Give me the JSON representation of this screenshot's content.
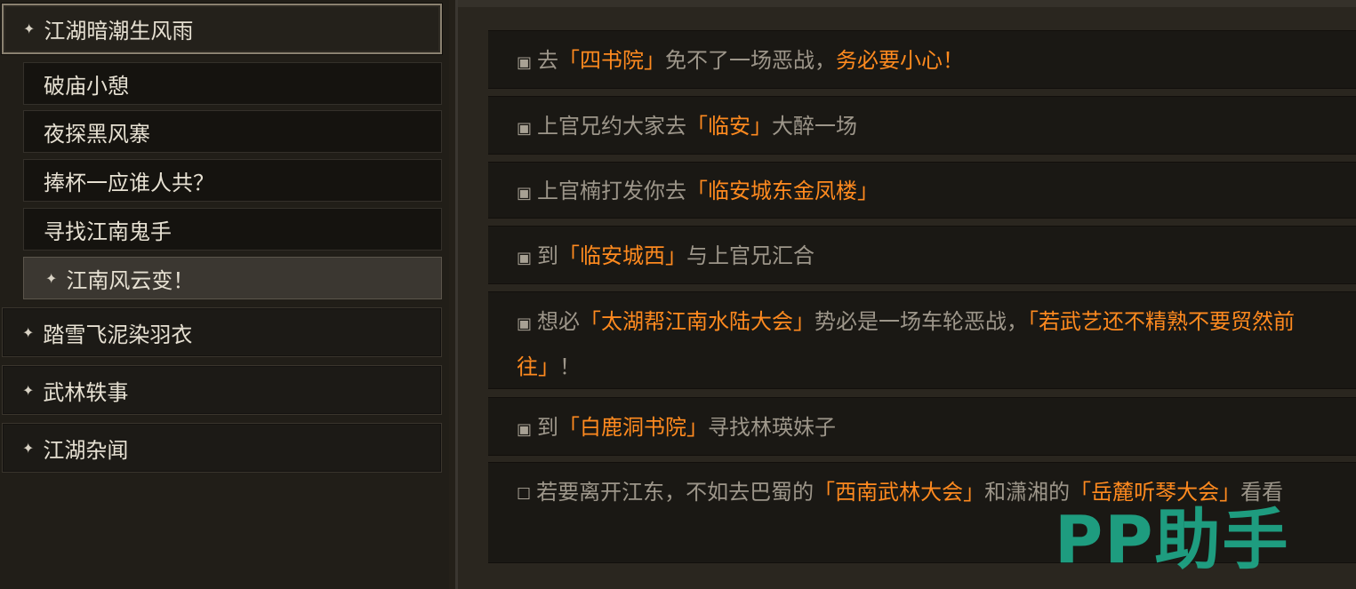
{
  "chapters": [
    {
      "icon": "plus-icon",
      "label": "江湖暗潮生风雨"
    },
    {
      "icon": "plus-icon",
      "label": "踏雪飞泥染羽衣"
    },
    {
      "icon": "plus-icon",
      "label": "武林轶事"
    },
    {
      "icon": "plus-icon",
      "label": "江湖杂闻"
    }
  ],
  "quests": [
    {
      "label": "破庙小憩"
    },
    {
      "label": "夜探黑风寨"
    },
    {
      "label": "捧杯一应谁人共？"
    },
    {
      "label": "寻找江南鬼手"
    },
    {
      "icon": "plus-icon",
      "label": "江南风云变！"
    }
  ],
  "entries": [
    {
      "box": "▣",
      "parts": [
        "去",
        "「四书院」",
        "免不了一场恶战，",
        "务必要小心！"
      ]
    },
    {
      "box": "▣",
      "parts": [
        "上官兄约大家去",
        "「临安」",
        "大醉一场"
      ]
    },
    {
      "box": "▣",
      "parts": [
        "上官楠打发你去",
        "「临安城东金凤楼」"
      ]
    },
    {
      "box": "▣",
      "parts": [
        "到",
        "「临安城西」",
        "与上官兄汇合"
      ]
    },
    {
      "box": "▣",
      "parts": [
        "想必",
        "「太湖帮江南水陆大会」",
        "势必是一场车轮恶战，",
        "「若武艺还不精熟不要贸然前往」",
        "！"
      ]
    },
    {
      "box": "▣",
      "parts": [
        "到",
        "「白鹿洞书院」",
        "寻找林瑛妹子"
      ]
    },
    {
      "box": "☐",
      "parts": [
        "若要离开江东，不如去巴蜀的",
        "「西南武林大会」",
        "和潇湘的",
        "「岳麓听琴大会」",
        "看看"
      ]
    }
  ],
  "watermark": "PP助手",
  "colors": {
    "highlight": "#ff8a1f",
    "text": "#9d968a",
    "menu_text": "#e6e0d2",
    "watermark": "#1fa889"
  }
}
